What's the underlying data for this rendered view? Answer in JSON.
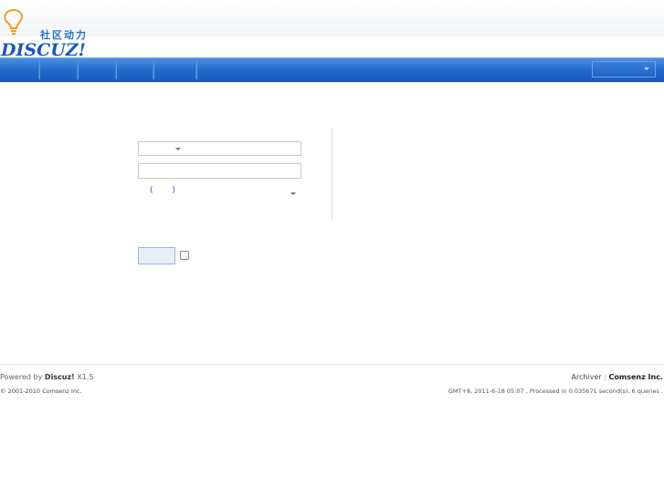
{
  "logo": {
    "cn_text": "社区动力",
    "brand": "DISCUZ!"
  },
  "footer": {
    "powered_by": "Powered by",
    "product": "Discuz!",
    "version": "X1.5",
    "copyright": "© 2001-2010",
    "company_small": "Comsenz Inc.",
    "archiver": "Archiver",
    "separator": "|",
    "company": "Comsenz Inc.",
    "stats": "GMT+8, 2011-6-18 05:07 , Processed in 0.035671 second(s), 6 queries ."
  },
  "form": {
    "question_parens": "( )"
  },
  "colors": {
    "nav_bar": "#2267c9",
    "logo_blue": "#1a56b8",
    "logo_bulb": "#f0a020"
  }
}
